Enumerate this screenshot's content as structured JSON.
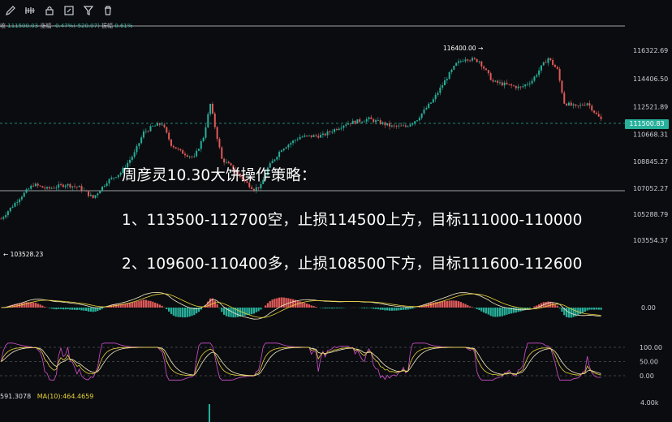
{
  "toolbar": {
    "icons": [
      "pencil-icon",
      "indicator-icon",
      "lock-icon",
      "edit-icon",
      "filter-icon",
      "trash-icon"
    ]
  },
  "stats": {
    "close_prefix": "收",
    "close": "111500.03",
    "change_label": "涨幅",
    "change": "-0.47%(-520.07)",
    "amplitude_label": "振幅",
    "amplitude": "0.61%"
  },
  "overlay": {
    "title": "周彦灵10.30大饼操作策略：",
    "line1": "1、113500-112700空，止损114500上方，目标111000-110000",
    "line2": "2、109600-110400多，止损108500下方，目标111600-112600"
  },
  "price_axis": {
    "ticks": [
      "116322.69",
      "114406.50",
      "112521.89",
      "110668.31",
      "108845.27",
      "107052.27",
      "105288.79",
      "103554.37"
    ],
    "current_price": "111500.83",
    "high_label": "116400.00 →",
    "low_label": "← 103528.23"
  },
  "macd_axis": {
    "zero": "0.00"
  },
  "kdj_axis": {
    "ticks": [
      "100.00",
      "50.00",
      "0.00"
    ]
  },
  "volume_axis": {
    "top": "4.00k"
  },
  "readout": {
    "a": "591.3078",
    "b": "MA(10):464.4659"
  },
  "colors": {
    "up": "#27b09b",
    "down": "#e25a5a",
    "k_line": "#e8d23a",
    "d_line": "#f3ecc8",
    "j_line": "#d24fd0",
    "price_tag": "#27b09b"
  },
  "chart_data": {
    "type": "candlestick",
    "anchors": [
      [
        0,
        105000
      ],
      [
        8,
        106400
      ],
      [
        14,
        107300
      ],
      [
        20,
        107000
      ],
      [
        28,
        107300
      ],
      [
        34,
        107100
      ],
      [
        40,
        106400
      ],
      [
        46,
        107500
      ],
      [
        52,
        108100
      ],
      [
        58,
        109400
      ],
      [
        62,
        110800
      ],
      [
        66,
        111200
      ],
      [
        70,
        111400
      ],
      [
        74,
        110000
      ],
      [
        78,
        109500
      ],
      [
        84,
        109100
      ],
      [
        88,
        110500
      ],
      [
        91,
        112700
      ],
      [
        93,
        111200
      ],
      [
        96,
        109000
      ],
      [
        100,
        108500
      ],
      [
        106,
        107500
      ],
      [
        110,
        107000
      ],
      [
        113,
        107200
      ],
      [
        116,
        108400
      ],
      [
        122,
        109700
      ],
      [
        130,
        110500
      ],
      [
        140,
        110600
      ],
      [
        150,
        111400
      ],
      [
        160,
        111700
      ],
      [
        170,
        111200
      ],
      [
        176,
        111200
      ],
      [
        181,
        111700
      ],
      [
        188,
        113000
      ],
      [
        194,
        114500
      ],
      [
        198,
        115400
      ],
      [
        202,
        115800
      ],
      [
        208,
        115600
      ],
      [
        214,
        114200
      ],
      [
        220,
        114000
      ],
      [
        226,
        113800
      ],
      [
        231,
        114300
      ],
      [
        235,
        115200
      ],
      [
        238,
        115800
      ],
      [
        242,
        115000
      ],
      [
        245,
        112800
      ],
      [
        250,
        112500
      ],
      [
        255,
        112800
      ],
      [
        259,
        112000
      ],
      [
        262,
        111500
      ]
    ],
    "bar_count": 262
  }
}
